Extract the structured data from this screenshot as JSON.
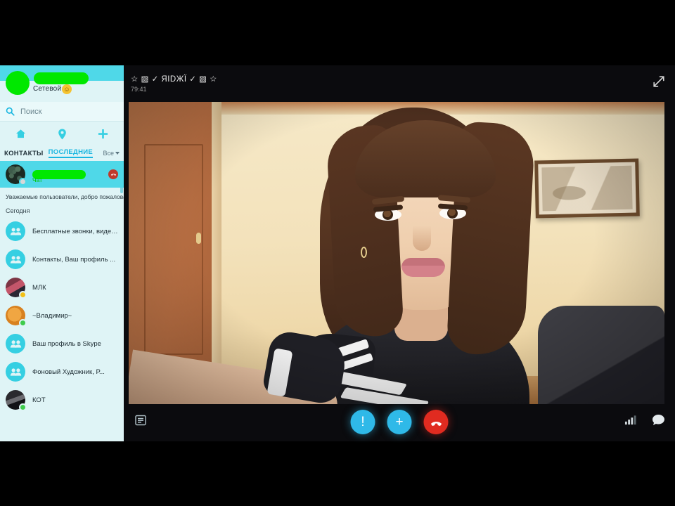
{
  "app": {
    "name": "Skype",
    "language": "ru"
  },
  "sidebar": {
    "me": {
      "display_name_redacted": true,
      "status_text": "Сетевой",
      "mood_emoji": "☺"
    },
    "search": {
      "placeholder": "Поиск",
      "value": "",
      "icon": "search-icon"
    },
    "nav_icons": [
      {
        "name": "home-icon"
      },
      {
        "name": "location-pin-icon"
      },
      {
        "name": "add-contact-icon"
      }
    ],
    "tabs": [
      {
        "label": "КОНТАКТЫ",
        "active": false
      },
      {
        "label": "ПОСЛЕДНИЕ",
        "active": true
      }
    ],
    "filter": {
      "label": "Все",
      "icon": "chevron-down-icon"
    },
    "selected_conversation": {
      "name_redacted": true,
      "subtitle": "Чат",
      "badge_icon": "missed-call-icon",
      "presence": "photo"
    },
    "info_line": "Уважаемые пользователи, добро пожаловать в ...",
    "day_divider": "Сегодня",
    "recent_items": [
      {
        "name": "Бесплатные звонки, видеоз...",
        "avatar": "group",
        "presence": "none"
      },
      {
        "name": "Контакты, Ваш профиль ...",
        "avatar": "group",
        "presence": "none"
      },
      {
        "name": "МЛК",
        "avatar": "photo",
        "presence": "away"
      },
      {
        "name": "~Владимир~",
        "avatar": "photo",
        "presence": "online"
      },
      {
        "name": "Ваш профиль в Skype",
        "avatar": "group",
        "presence": "none"
      },
      {
        "name": "Фоновый Художник, Р...",
        "avatar": "group",
        "presence": "none"
      },
      {
        "name": "КОТ",
        "avatar": "photo",
        "presence": "online"
      }
    ]
  },
  "call": {
    "title": "☆ ▨ ✓ ЯІDЖЇ ✓ ▨ ☆",
    "timer": "79:41",
    "expand_icon": "expand-arrows-icon",
    "controls": {
      "left_icon": "chat-panel-icon",
      "buttons": [
        {
          "name": "mute-alert-button",
          "glyph": "!",
          "color": "#2fb9e8"
        },
        {
          "name": "add-participant-button",
          "glyph": "+",
          "color": "#2fb9e8"
        },
        {
          "name": "end-call-button",
          "glyph": "handset",
          "color": "#e02b20"
        }
      ],
      "right_icons": [
        {
          "name": "call-quality-icon"
        },
        {
          "name": "chat-bubble-icon"
        }
      ]
    }
  },
  "colors": {
    "skype_blue": "#2fb9e8",
    "sidebar_bg": "#dff4f6",
    "selected_row": "#4fd8e8",
    "hangup_red": "#e02b20",
    "redaction_green": "#00e800"
  }
}
